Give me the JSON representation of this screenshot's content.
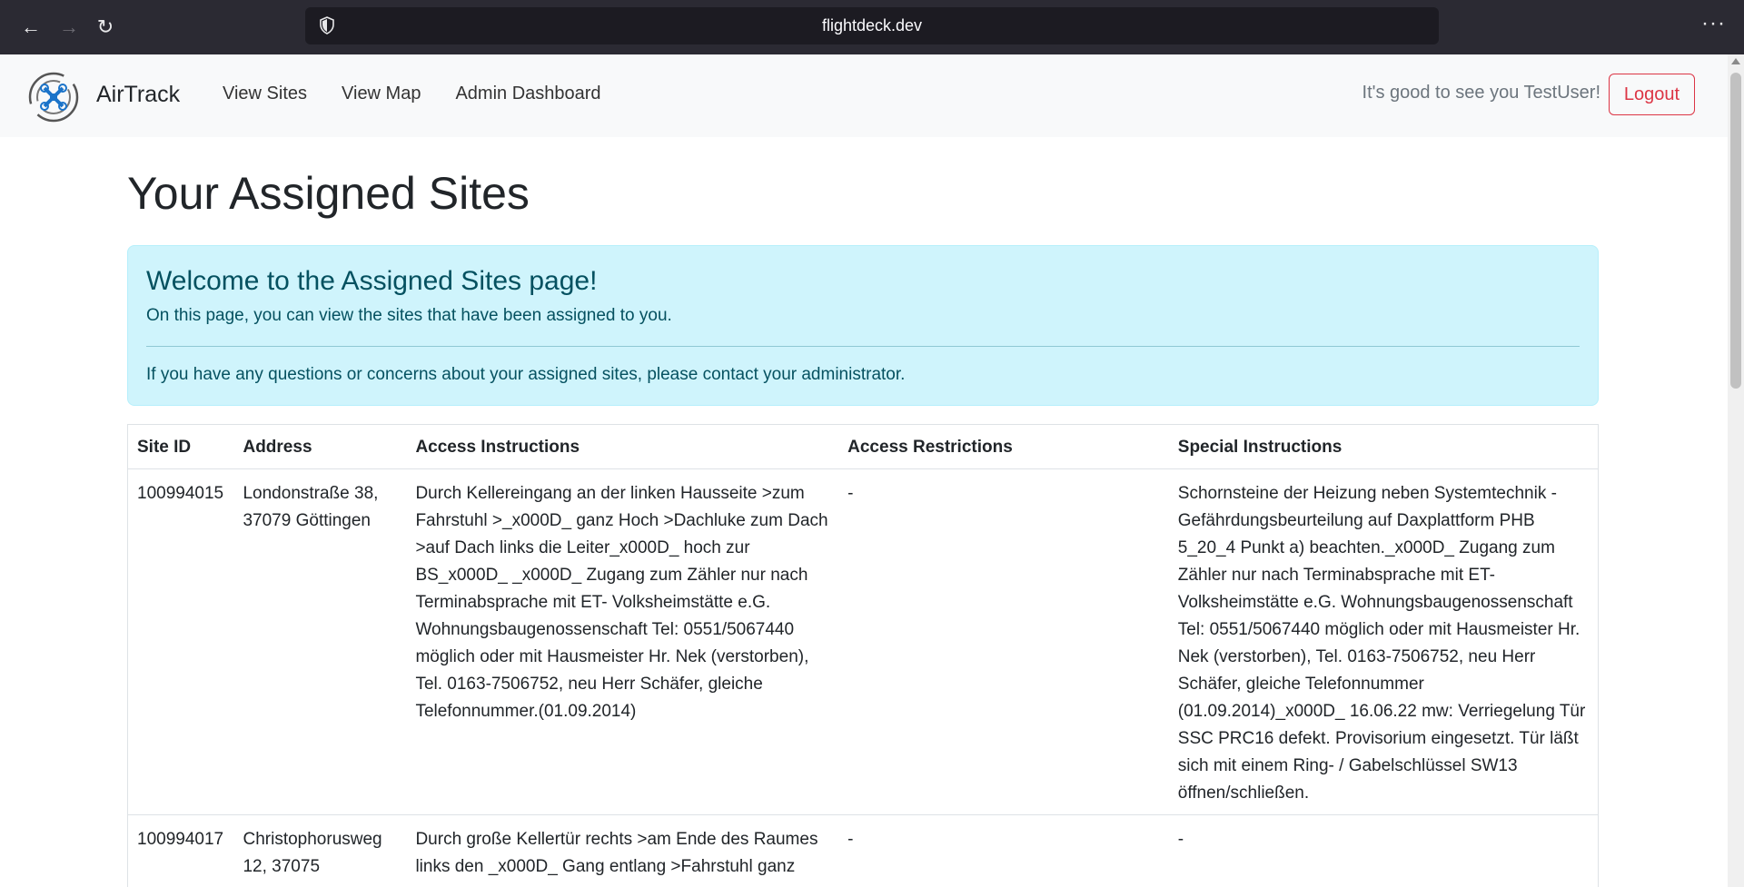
{
  "browser": {
    "url": "flightdeck.dev",
    "back_icon": "←",
    "forward_icon": "→",
    "reload_icon": "↻",
    "menu_icon": "···"
  },
  "navbar": {
    "brand": "AirTrack",
    "links": [
      "View Sites",
      "View Map",
      "Admin Dashboard"
    ],
    "greeting": "It's good to see you TestUser!",
    "logout": "Logout"
  },
  "page": {
    "title": "Your Assigned Sites",
    "alert": {
      "heading": "Welcome to the Assigned Sites page!",
      "line1": "On this page, you can view the sites that have been assigned to you.",
      "line2": "If you have any questions or concerns about your assigned sites, please contact your administrator."
    }
  },
  "table": {
    "headers": [
      "Site ID",
      "Address",
      "Access Instructions",
      "Access Restrictions",
      "Special Instructions"
    ],
    "rows": [
      {
        "site_id": "100994015",
        "address": "Londonstraße 38, 37079 Göttingen",
        "access_instructions": "Durch Kellereingang an der linken Hausseite >zum Fahrstuhl >_x000D_ ganz Hoch >Dachluke zum Dach >auf Dach links die Leiter_x000D_ hoch zur BS_x000D_ _x000D_ Zugang zum Zähler nur nach Terminabsprache mit ET- Volksheimstätte e.G. Wohnungsbaugenossenschaft Tel: 0551/5067440 möglich oder mit Hausmeister Hr. Nek (verstorben), Tel. 0163-7506752, neu Herr Schäfer, gleiche Telefonnummer.(01.09.2014)",
        "access_restrictions": "-",
        "special_instructions": "Schornsteine der Heizung neben Systemtechnik - Gefährdungsbeurteilung auf Daxplattform PHB 5_20_4 Punkt a) beachten._x000D_ Zugang zum Zähler nur nach Terminabsprache mit ET-Volksheimstätte e.G. Wohnungsbaugenossenschaft Tel: 0551/5067440 möglich oder mit Hausmeister Hr. Nek (verstorben), Tel. 0163-7506752, neu Herr Schäfer, gleiche Telefonnummer (01.09.2014)_x000D_ 16.06.22 mw: Verriegelung Tür SSC PRC16 defekt. Provisorium eingesetzt. Tür läßt sich mit einem Ring- / Gabelschlüssel SW13 öffnen/schließen."
      },
      {
        "site_id": "100994017",
        "address": "Christophorusweg 12, 37075",
        "access_instructions": "Durch große Kellertür rechts >am Ende des Raumes links den _x000D_ Gang entlang >Fahrstuhl ganz",
        "access_restrictions": "-",
        "special_instructions": "-"
      }
    ]
  }
}
